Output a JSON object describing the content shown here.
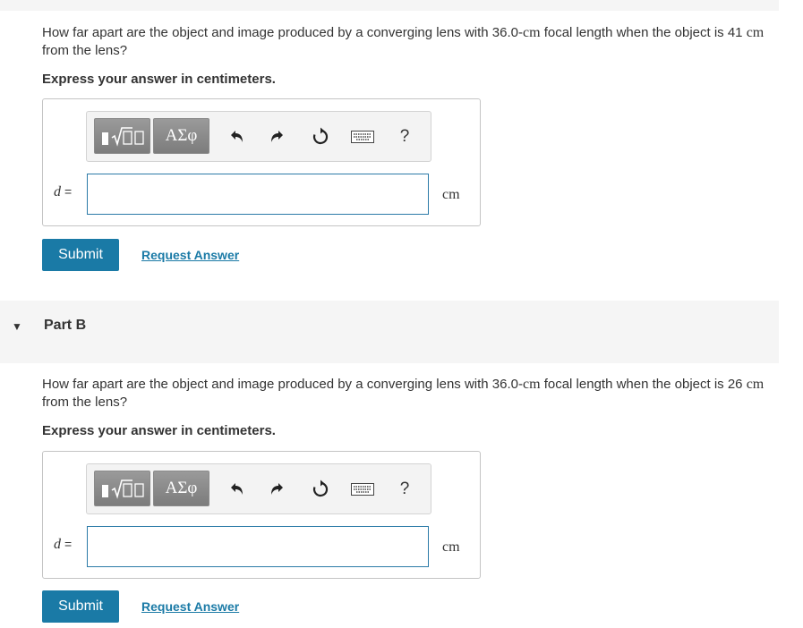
{
  "part_a": {
    "question_pre": "How far apart are the object and image produced by a converging lens with 36.0-",
    "focal_unit": "cm",
    "question_mid": " focal length when the object is 41 ",
    "distance_unit": "cm",
    "question_post": " from the lens?",
    "instruction": "Express your answer in centimeters.",
    "variable": "d",
    "equals": "=",
    "input_value": "",
    "unit": "cm",
    "submit_label": "Submit",
    "request_label": "Request Answer"
  },
  "part_b": {
    "header": "Part B",
    "question_pre": "How far apart are the object and image produced by a converging lens with 36.0-",
    "focal_unit": "cm",
    "question_mid": " focal length when the object is 26 ",
    "distance_unit": "cm",
    "question_post": " from the lens?",
    "instruction": "Express your answer in centimeters.",
    "variable": "d",
    "equals": "=",
    "input_value": "",
    "unit": "cm",
    "submit_label": "Submit",
    "request_label": "Request Answer"
  },
  "toolbar": {
    "greek_label": "ΑΣφ",
    "help_label": "?",
    "icons": [
      "template-icon",
      "undo-icon",
      "redo-icon",
      "reset-icon",
      "keyboard-icon",
      "help-icon"
    ]
  },
  "colors": {
    "accent": "#1a7aa6",
    "input_border": "#2c7ba8",
    "toolbar_button": "#888888",
    "section_bg": "#f5f5f5"
  }
}
